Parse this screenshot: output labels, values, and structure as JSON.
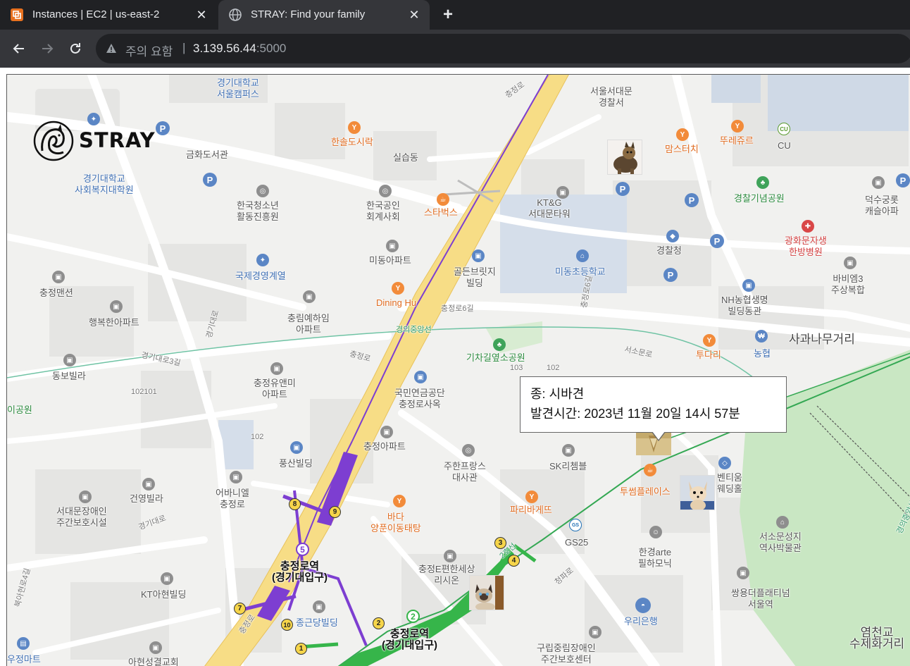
{
  "browser": {
    "tabs": [
      {
        "title": "Instances | EC2 | us-east-2",
        "active": false,
        "icon": "aws-ec2-icon"
      },
      {
        "title": "STRAY: Find your family",
        "active": true,
        "icon": "globe-icon"
      }
    ],
    "address": {
      "security_label": "주의 요함",
      "host": "3.139.56.44",
      "port": ":5000"
    }
  },
  "app": {
    "logo_text": "STRAY"
  },
  "infowindow": {
    "line1": "종: 시바견",
    "line2": "발견시간: 2023년 11월 20일 14시 57분"
  },
  "map": {
    "labels": {
      "kyonggi_seoul": "경기대학교\n서울캠퍼스",
      "seodaemun_police": "서울서대문\n경찰서",
      "geumhwa_library": "금화도서관",
      "kyonggi_social": "경기대학교\n사회복지대학원",
      "hansol": "한솔도시락",
      "silseup": "실습동",
      "mamstouch": "맘스터치",
      "ttuere": "뚜레쥬르",
      "cu": "CU",
      "deoksu": "덕수궁롯\n캐슬아파",
      "youth_center": "한국청소년\n활동진흥원",
      "cpa": "한국공인\n회계사회",
      "starbucks": "스타벅스",
      "ktg": "KT&G\n서대문타워",
      "police_park": "경찰기념공원",
      "gwanghwamun_hospital": "광화문자생\n한방병원",
      "police_agency": "경찰청",
      "intl_contract": "국제경영계열",
      "midong_apt": "미동아파트",
      "golden_bridge": "골든브릿지\n빌딩",
      "midong_school": "미동초등학교",
      "babiem": "바비엠3\n주상복합",
      "chungjeong_mansion": "충정맨션",
      "haengbok": "행복한아파트",
      "dining": "Dining Hu",
      "chungnim": "충림예하임\n아파트",
      "nh": "NH농협생명\n빌딩동관",
      "sagwa": "사과나무거리",
      "nonghyup": "농협",
      "dongbo": "동보빌라",
      "chungjeong_yuemi": "충정유앤미\n아파트",
      "gichagil": "기차길옆소공원",
      "tudari": "투다리",
      "lake_park": "이공원",
      "nps": "국민연금공단\n충정로사옥",
      "chungjeong_apt": "충정아파트",
      "pungsan": "풍산빌딩",
      "juhan": "주한프랑스\n대사관",
      "sk": "SK리쳄블",
      "tossom": "투썸플레이스",
      "benti": "벤티움\n웨딩홀",
      "abany": "어바니엘\n충정로",
      "geonyoung": "건영빌라",
      "seodaemun_care": "서대문장애인\n주간보호시설",
      "bada": "바다\n양푼이동태탕",
      "paris": "파리바게뜨",
      "gs25": "GS25",
      "hangyeol": "한경arte\n필하모닉",
      "seosomun": "서소문성지\n역사박물관",
      "station1": "충정로역\n(경기대입구)",
      "ehansesang": "충정E편한세상\n리시온",
      "ktahyeon": "KT아현빌딩",
      "ssangyong": "쌍용더플래티넘\n서울역",
      "jonggeun": "종근당빌딩",
      "station2": "충정로역\n(경기대입구)",
      "woori": "우리은행",
      "guri_care": "구립중림장애인\n주간보호센터",
      "yeomcheon": "염천교\n수제화거리",
      "woojeong": "우정마트",
      "ahyeon_church": "아현성결교회",
      "road_chungjeong": "충정로",
      "road_chungjeong6": "충정로6길",
      "road_gyeonggi3": "경기대로3길",
      "road_gyeonggi": "경기대로",
      "road_seosomun": "서소문로",
      "rail_gyeongui": "경의중앙선",
      "road_bukahyeon": "북아현로4길",
      "road_cheongpa": "청파로",
      "n102101": "102101",
      "n102": "102",
      "n103": "103",
      "n102b": "102",
      "line2": "2호선"
    }
  }
}
